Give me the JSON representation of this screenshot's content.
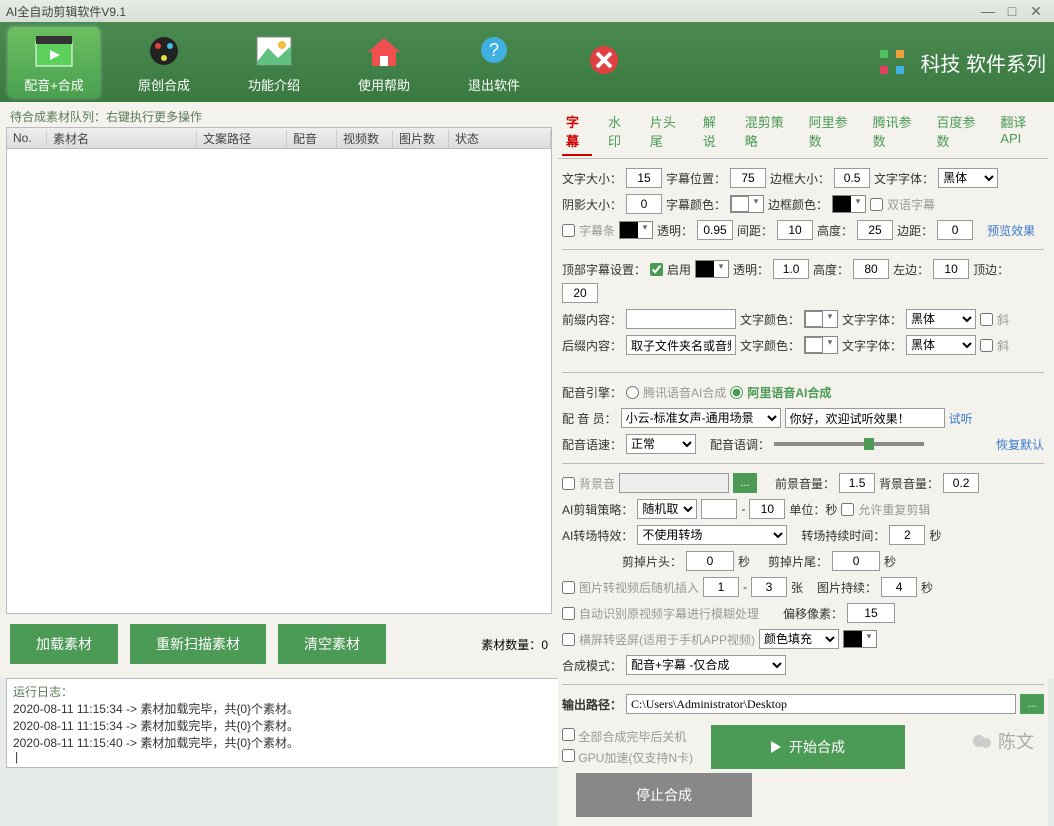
{
  "title": "AI全自动剪辑软件V9.1",
  "ribbon": {
    "items": [
      "配音+合成",
      "原创合成",
      "功能介绍",
      "使用帮助",
      "退出软件"
    ],
    "brand": "科技 软件系列"
  },
  "left": {
    "caption": "待合成素材队列：右键执行更多操作",
    "cols": [
      "No.",
      "素材名",
      "文案路径",
      "配音",
      "视频数",
      "图片数",
      "状态"
    ],
    "buttons": {
      "load": "加载素材",
      "rescan": "重新扫描素材",
      "clear": "清空素材"
    },
    "count_label": "素材数量：",
    "count_value": "0"
  },
  "tabs": [
    "字幕",
    "水印",
    "片头尾",
    "解说",
    "混剪策略",
    "阿里参数",
    "腾讯参数",
    "百度参数",
    "翻译API"
  ],
  "sub": {
    "fontSizeLbl": "文字大小：",
    "fontSize": "15",
    "posLbl": "字幕位置：",
    "pos": "75",
    "borderSizeLbl": "边框大小：",
    "borderSize": "0.5",
    "fontLbl": "文字字体：",
    "font": "黑体",
    "shadowLbl": "阴影大小：",
    "shadow": "0",
    "colorLbl": "字幕颜色：",
    "borderColorLbl": "边框颜色：",
    "bilingual": "双语字幕",
    "bgBarLbl": "字幕条",
    "alphaLbl": "透明：",
    "alpha": "0.95",
    "gapLbl": "间距：",
    "gap": "10",
    "heightLbl": "高度：",
    "height": "25",
    "marginLbl": "边距：",
    "margin": "0",
    "previewBtn": "预览效果",
    "topSetLbl": "顶部字幕设置：",
    "enable": "启用",
    "alpha2": "1.0",
    "height2": "80",
    "leftLbl": "左边：",
    "left2": "10",
    "topLbl": "顶边：",
    "top2": "20",
    "prefixLbl": "前缀内容：",
    "colorLbl2": "文字颜色：",
    "fontLbl2": "文字字体：",
    "font2": "黑体",
    "italic": "斜",
    "suffixLbl": "后缀内容：",
    "suffix": "取子文件夹名或音频",
    "font3": "黑体"
  },
  "voice": {
    "engineLbl": "配音引擎：",
    "engine1": "腾讯语音AI合成",
    "engine2": "阿里语音AI合成",
    "voicerLbl": "配 音 员：",
    "voicer": "小云-标准女声-通用场景",
    "sample": "你好，欢迎试听效果！",
    "listen": "试听",
    "speedLbl": "配音语速：",
    "speed": "正常",
    "pitchLbl": "配音语调：",
    "reset": "恢复默认",
    "bgm": "背景音",
    "fgVolLbl": "前景音量：",
    "fgVol": "1.5",
    "bgVolLbl": "背景音量：",
    "bgVol": "0.2",
    "clipLbl": "AI剪辑策略：",
    "clip": "随机取",
    "clipTo": "10",
    "unitLbl": "单位：秒",
    "dupChk": "允许重复剪辑",
    "transLbl": "AI转场特效：",
    "trans": "不使用转场",
    "transDurLbl": "转场持续时间：",
    "transDur": "2",
    "sec": "秒",
    "cutHeadLbl": "剪掉片头：",
    "cutHead": "0",
    "cutTailLbl": "剪掉片尾：",
    "cutTail": "0",
    "img2vid": "图片转视频后随机插入",
    "imgFrom": "1",
    "imgTo": "3",
    "zhang": "张",
    "imgDurLbl": "图片持续：",
    "imgDur": "4",
    "autoBlur": "自动识别原视频字幕进行模糊处理",
    "offsetLbl": "偏移像素：",
    "offset": "15",
    "rot": "横屏转竖屏(适用于手机APP视频)",
    "fill": "颜色填充",
    "modeLbl": "合成模式：",
    "mode": "配音+字幕 -仅合成",
    "outLbl": "输出路径：",
    "out": "C:\\Users\\Administrator\\Desktop",
    "shutdown": "全部合成完毕后关机",
    "gpu": "GPU加速(仅支持N卡)",
    "start": "开始合成",
    "stop": "停止合成"
  },
  "log": {
    "title": "运行日志：",
    "lines": [
      "2020-08-11 11:15:34 -> 素材加载完毕，共{0}个素材。",
      "2020-08-11 11:15:34 -> 素材加载完毕，共{0}个素材。",
      "2020-08-11 11:15:40 -> 素材加载完毕，共{0}个素材。"
    ]
  },
  "watermark": "陈文"
}
